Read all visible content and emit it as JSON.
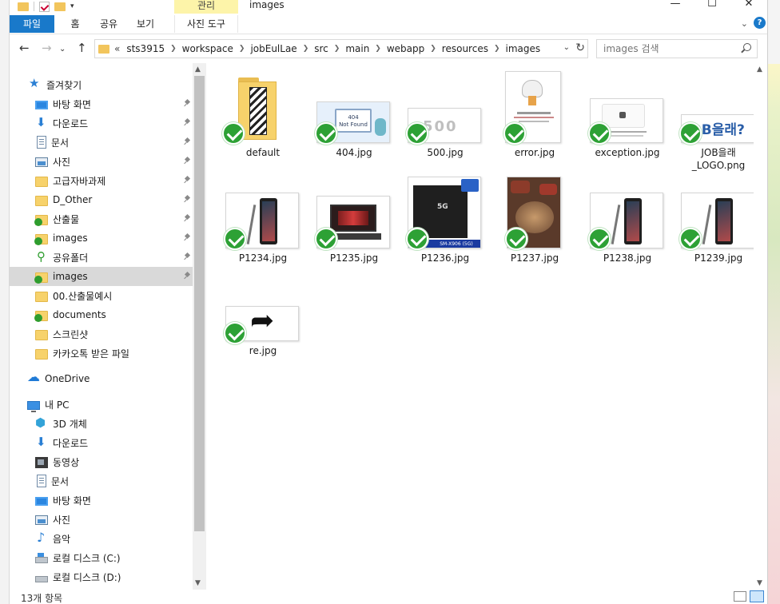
{
  "window": {
    "title": "images",
    "context_tab_label": "관리",
    "controls": {
      "minimize": "—",
      "maximize": "☐",
      "close": "✕"
    }
  },
  "ribbon": {
    "tabs": [
      "파일",
      "홈",
      "공유",
      "보기",
      "사진 도구"
    ],
    "help": "?"
  },
  "address": {
    "overflow": "«",
    "crumbs": [
      "sts3915",
      "workspace",
      "jobEulLae",
      "src",
      "main",
      "webapp",
      "resources",
      "images"
    ]
  },
  "search": {
    "placeholder": "images 검색"
  },
  "nav": {
    "quick_access": "즐겨찾기",
    "items": [
      {
        "label": "바탕 화면",
        "icon": "desktop-icon"
      },
      {
        "label": "다운로드",
        "icon": "download-icon"
      },
      {
        "label": "문서",
        "icon": "document-icon"
      },
      {
        "label": "사진",
        "icon": "pictures-icon"
      },
      {
        "label": "고급자바과제",
        "icon": "folder-icon"
      },
      {
        "label": "D_Other",
        "icon": "folder-icon"
      },
      {
        "label": "산출물",
        "icon": "synced-folder-icon"
      },
      {
        "label": "images",
        "icon": "synced-folder-icon"
      },
      {
        "label": "공유폴더",
        "icon": "share-icon"
      },
      {
        "label": "images",
        "icon": "synced-folder-icon"
      },
      {
        "label": "00.산출물예시",
        "icon": "folder-icon"
      },
      {
        "label": "documents",
        "icon": "synced-folder-icon"
      },
      {
        "label": "스크린샷",
        "icon": "folder-icon"
      },
      {
        "label": "카카오톡 받은 파일",
        "icon": "folder-icon"
      }
    ],
    "onedrive": "OneDrive",
    "this_pc": "내 PC",
    "pc_items": [
      {
        "label": "3D 개체",
        "icon": "3d-objects-icon"
      },
      {
        "label": "다운로드",
        "icon": "download-icon"
      },
      {
        "label": "동영상",
        "icon": "videos-icon"
      },
      {
        "label": "문서",
        "icon": "document-icon"
      },
      {
        "label": "바탕 화면",
        "icon": "desktop-icon"
      },
      {
        "label": "사진",
        "icon": "pictures-icon"
      },
      {
        "label": "음악",
        "icon": "music-icon"
      },
      {
        "label": "로컬 디스크 (C:)",
        "icon": "drive-icon"
      },
      {
        "label": "로컬 디스크 (D:)",
        "icon": "drive-icon"
      }
    ]
  },
  "files": [
    {
      "name": "default",
      "kind": "folder"
    },
    {
      "name": "404.jpg",
      "kind": "image",
      "thumb_text": [
        "404",
        "Not Found"
      ]
    },
    {
      "name": "500.jpg",
      "kind": "image",
      "thumb_text": [
        "500"
      ]
    },
    {
      "name": "error.jpg",
      "kind": "image"
    },
    {
      "name": "exception.jpg",
      "kind": "image"
    },
    {
      "name": "JOB을래_LOGO.png",
      "name_lines": [
        "JOB을래",
        "_LOGO.png"
      ],
      "kind": "image",
      "thumb_text": [
        "JOB을래?"
      ]
    },
    {
      "name": "P1234.jpg",
      "kind": "image"
    },
    {
      "name": "P1235.jpg",
      "kind": "image"
    },
    {
      "name": "P1236.jpg",
      "kind": "image",
      "thumb_text": [
        "5G",
        "SM-X906 (5G)"
      ]
    },
    {
      "name": "P1237.jpg",
      "kind": "image"
    },
    {
      "name": "P1238.jpg",
      "kind": "image"
    },
    {
      "name": "P1239.jpg",
      "kind": "image"
    },
    {
      "name": "re.jpg",
      "kind": "image"
    }
  ],
  "status": {
    "count": "13개 항목"
  },
  "colors": {
    "accent": "#1979ca",
    "selection": "#cce8ff",
    "sync_ok": "#2da135",
    "context_tab": "#fdf4a9"
  }
}
